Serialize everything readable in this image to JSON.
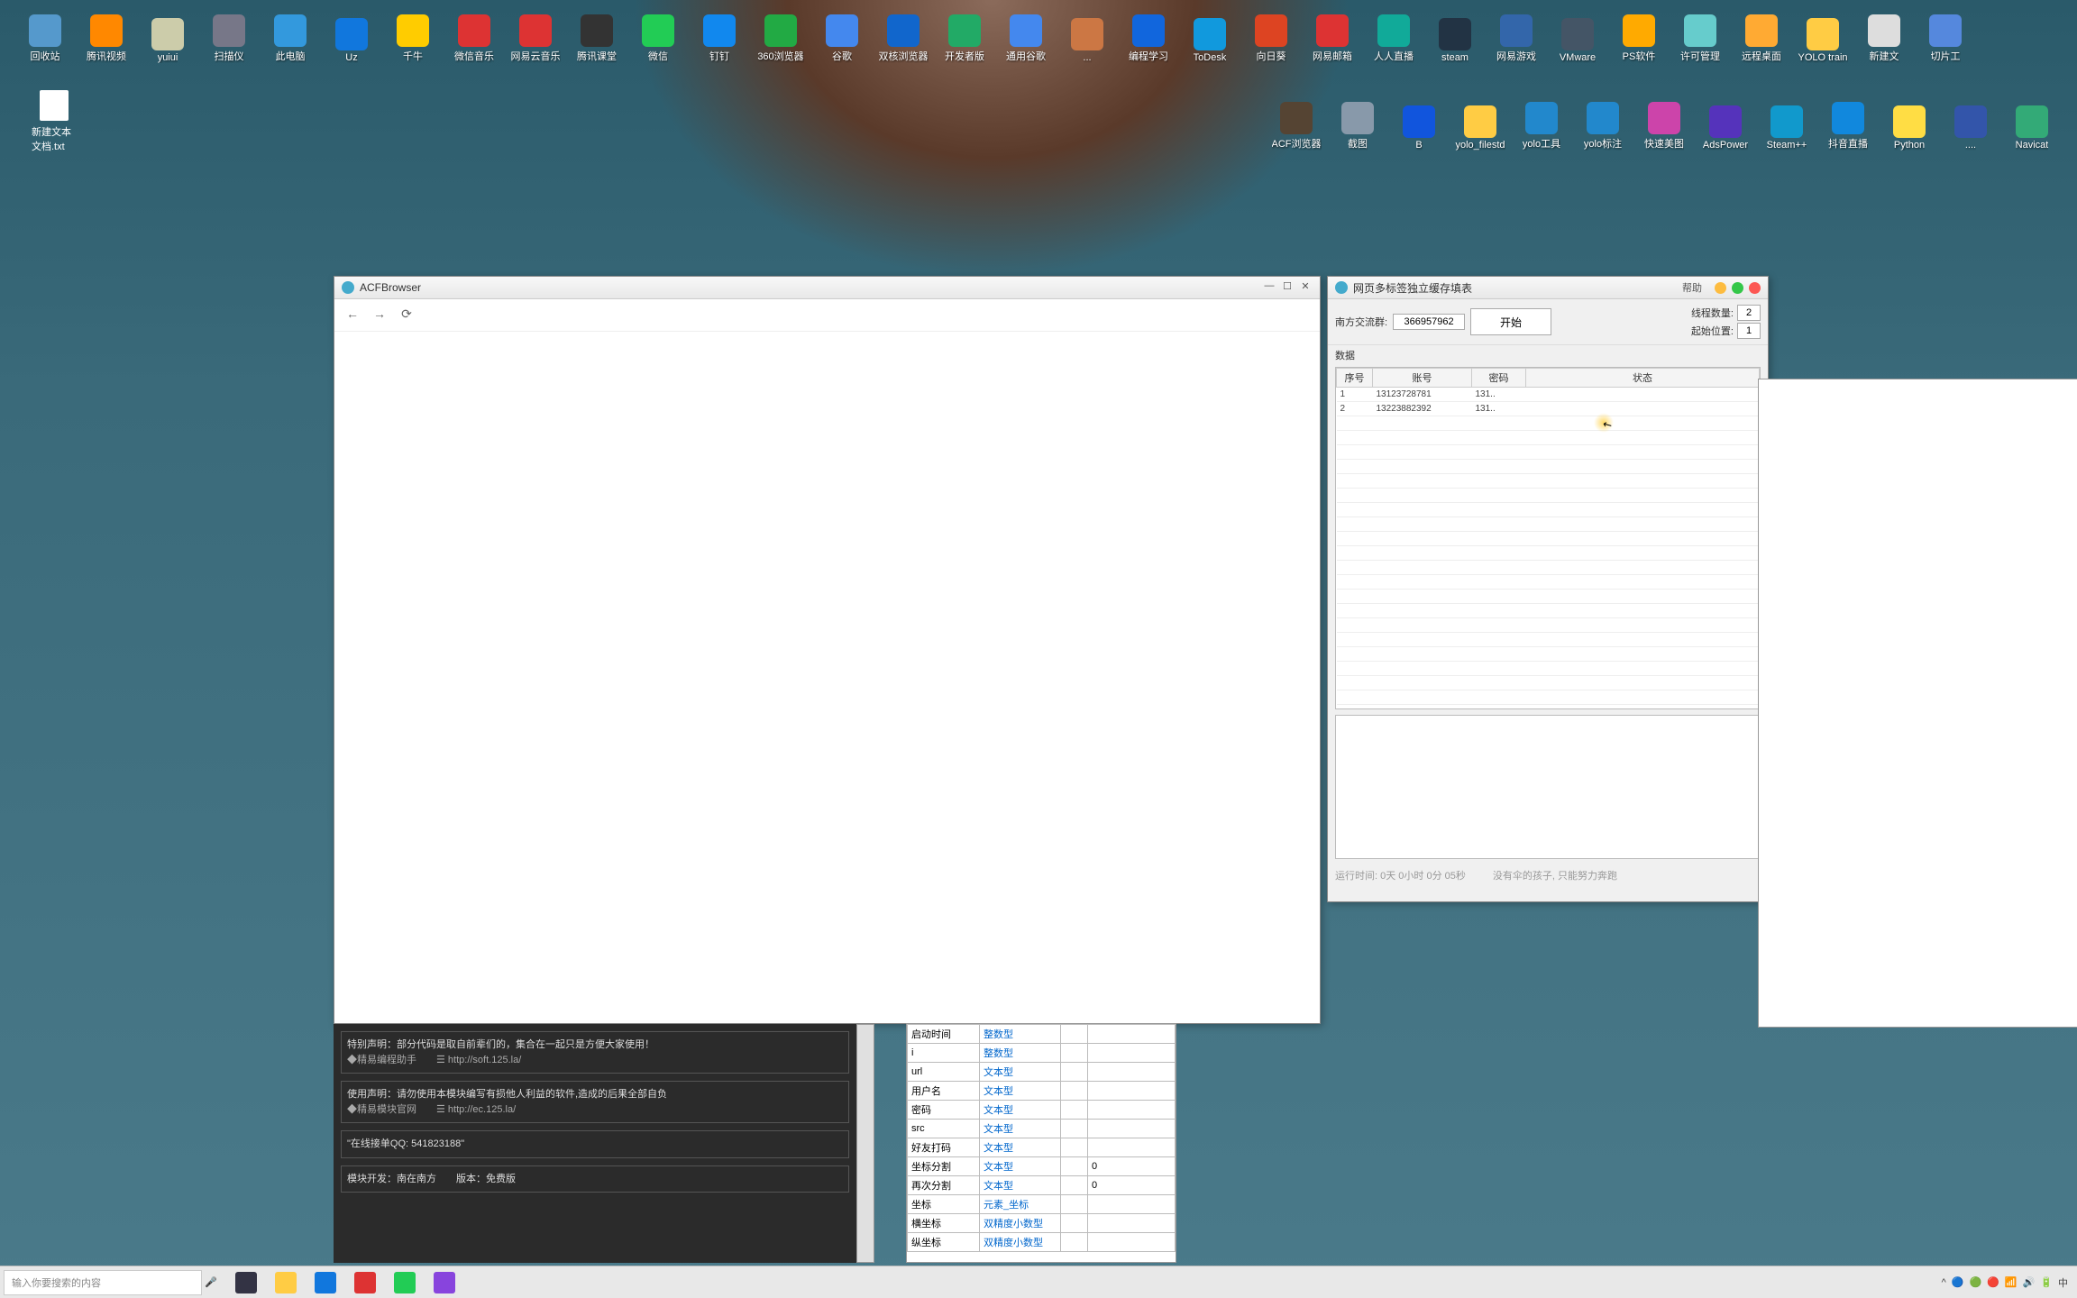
{
  "desktop": {
    "row1": [
      {
        "label": "回收站",
        "color": "#5599cc"
      },
      {
        "label": "腾讯视频",
        "color": "#ff8800"
      },
      {
        "label": "yuiui",
        "color": "#ccccaa"
      },
      {
        "label": "扫描仪",
        "color": "#777788"
      },
      {
        "label": "此电脑",
        "color": "#3399dd"
      },
      {
        "label": "Uz",
        "color": "#1177dd"
      },
      {
        "label": "千牛",
        "color": "#ffcc00"
      },
      {
        "label": "微信音乐",
        "color": "#dd3333"
      },
      {
        "label": "网易云音乐",
        "color": "#dd3333"
      },
      {
        "label": "腾讯课堂",
        "color": "#333333"
      },
      {
        "label": "微信",
        "color": "#22cc55"
      },
      {
        "label": "钉钉",
        "color": "#1188ee"
      },
      {
        "label": "360浏览器",
        "color": "#22aa44"
      },
      {
        "label": "谷歌",
        "color": "#4488ee"
      },
      {
        "label": "双核浏览器",
        "color": "#1166cc"
      },
      {
        "label": "开发者版",
        "color": "#22aa66"
      },
      {
        "label": "通用谷歌",
        "color": "#4488ee"
      },
      {
        "label": "...",
        "color": "#cc7744"
      },
      {
        "label": "编程学习",
        "color": "#1166dd"
      },
      {
        "label": "ToDesk",
        "color": "#1199dd"
      },
      {
        "label": "向日葵",
        "color": "#dd4422"
      },
      {
        "label": "网易邮箱",
        "color": "#dd3333"
      },
      {
        "label": "人人直播",
        "color": "#11aa99"
      },
      {
        "label": "steam",
        "color": "#223344"
      },
      {
        "label": "网易游戏",
        "color": "#3366aa"
      },
      {
        "label": "VMware",
        "color": "#445566"
      },
      {
        "label": "PS软件",
        "color": "#ffaa00"
      },
      {
        "label": "许可管理",
        "color": "#66cccc"
      },
      {
        "label": "远程桌面",
        "color": "#ffaa33"
      },
      {
        "label": "YOLO train",
        "color": "#ffcc44"
      },
      {
        "label": "新建文",
        "color": "#dddddd"
      },
      {
        "label": "切片工",
        "color": "#5588dd"
      }
    ],
    "row2": [
      {
        "label": "ACF浏览器",
        "color": "#554433"
      },
      {
        "label": "截图",
        "color": "#8899aa"
      },
      {
        "label": "B",
        "color": "#1155dd"
      },
      {
        "label": "yolo_filestd",
        "color": "#ffcc44"
      },
      {
        "label": "yolo工具",
        "color": "#2288cc"
      },
      {
        "label": "yolo标注",
        "color": "#2288cc"
      },
      {
        "label": "快速美图",
        "color": "#cc44aa"
      },
      {
        "label": "AdsPower",
        "color": "#5533bb"
      },
      {
        "label": "Steam++",
        "color": "#1199cc"
      },
      {
        "label": "抖音直播",
        "color": "#1188dd"
      },
      {
        "label": "Python",
        "color": "#ffdd44"
      },
      {
        "label": "....",
        "color": "#3355aa"
      },
      {
        "label": "Navicat",
        "color": "#33aa77"
      }
    ],
    "doc_label": "新建文本文档.txt"
  },
  "browser": {
    "title": "ACFBrowser",
    "back": "←",
    "forward": "→",
    "reload": "⟳"
  },
  "data_win": {
    "title": "网页多标签独立缓存填表",
    "help": "帮助",
    "group_label": "南方交流群:",
    "group_value": "366957962",
    "start_btn": "开始",
    "thread_label": "线程数量:",
    "thread_value": "2",
    "start_pos_label": "起始位置:",
    "start_pos_value": "1",
    "section": "数据",
    "headers": [
      "序号",
      "账号",
      "密码",
      "状态"
    ],
    "rows": [
      {
        "seq": "1",
        "acc": "13123728781",
        "pwd": "131..",
        "status": ""
      },
      {
        "seq": "2",
        "acc": "13223882392",
        "pwd": "131..",
        "status": ""
      }
    ],
    "runtime_label": "运行时间:",
    "runtime_value": "0天 0小时 0分 05秒",
    "motto": "没有伞的孩子, 只能努力奔跑"
  },
  "ide": {
    "block1_l1": "特别声明：部分代码是取自前辈们的，集合在一起只是方便大家使用！",
    "block1_l2": "◆精易编程助手　　☰  http://soft.125.la/",
    "block2_l1": "使用声明：请勿使用本模块编写有损他人利益的软件,造成的后果全部自负",
    "block2_l2": "◆精易模块官网　　☰  http://ec.125.la/",
    "block3": "\"在线接单QQ: 541823188\"",
    "block4": "模块开发：南在南方　　版本：免费版",
    "vars": [
      {
        "name": "启动时间",
        "type": "整数型",
        "val": ""
      },
      {
        "name": "i",
        "type": "整数型",
        "val": ""
      },
      {
        "name": "url",
        "type": "文本型",
        "val": ""
      },
      {
        "name": "用户名",
        "type": "文本型",
        "val": ""
      },
      {
        "name": "密码",
        "type": "文本型",
        "val": ""
      },
      {
        "name": "src",
        "type": "文本型",
        "val": ""
      },
      {
        "name": "好友打码",
        "type": "文本型",
        "val": ""
      },
      {
        "name": "坐标分割",
        "type": "文本型",
        "val": "0"
      },
      {
        "name": "再次分割",
        "type": "文本型",
        "val": "0"
      },
      {
        "name": "坐标",
        "type": "元素_坐标",
        "val": ""
      },
      {
        "name": "横坐标",
        "type": "双精度小数型",
        "val": ""
      },
      {
        "name": "纵坐标",
        "type": "双精度小数型",
        "val": ""
      }
    ]
  },
  "taskbar": {
    "search_placeholder": "输入你要搜索的内容",
    "mic": "🎤",
    "tray": [
      "^",
      "🔵",
      "🟢",
      "🔴",
      "📶",
      "🔊",
      "🔋",
      "中"
    ]
  }
}
